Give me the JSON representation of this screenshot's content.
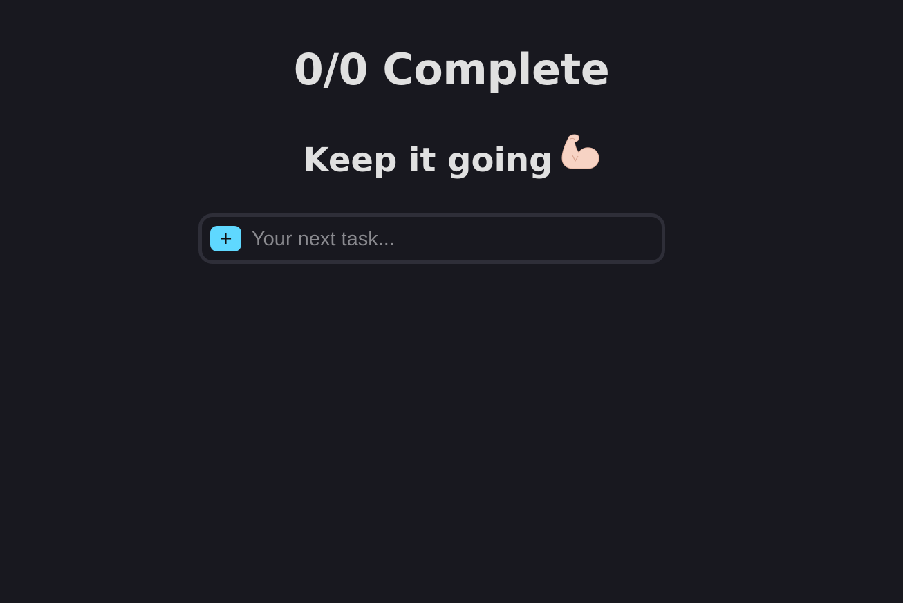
{
  "progress": {
    "title": "0/0 Complete",
    "completed": 0,
    "total": 0
  },
  "motivation": {
    "text": "Keep it going",
    "icon": "flexed-biceps-icon"
  },
  "task_form": {
    "add_label": "+",
    "input_placeholder": "Your next task...",
    "input_value": ""
  },
  "colors": {
    "background": "#18181f",
    "accent": "#5fd8ff",
    "border": "#2e2e38",
    "text": "#e0e0e0"
  }
}
